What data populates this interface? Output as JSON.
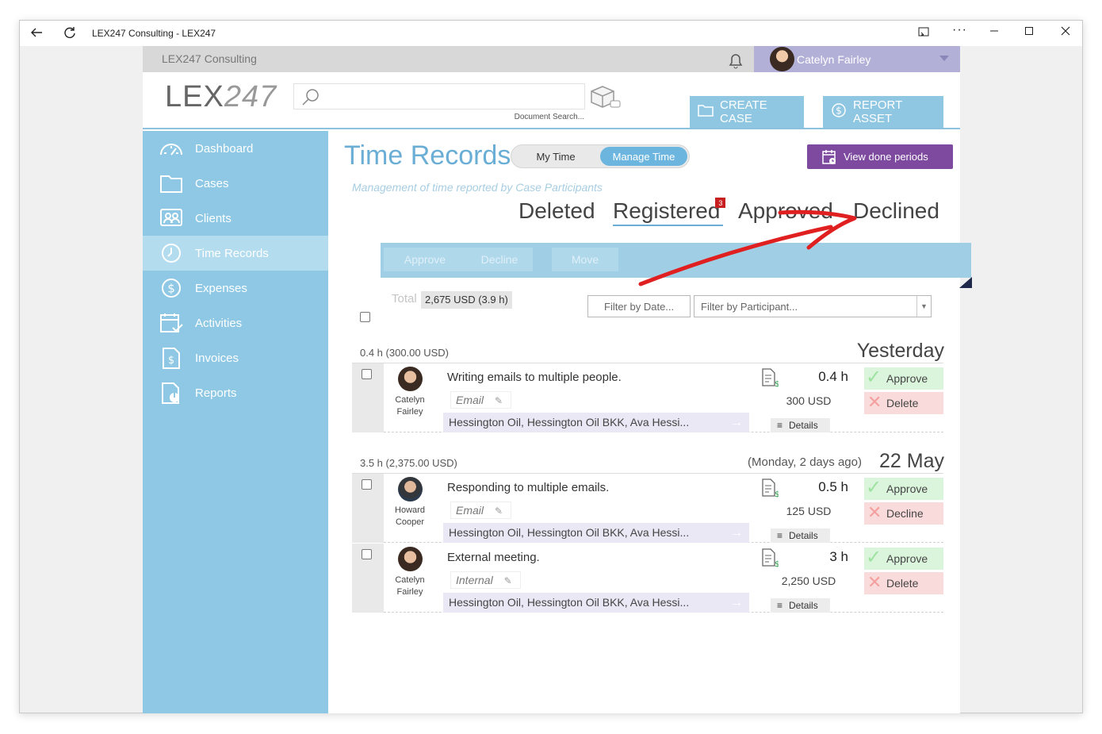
{
  "window": {
    "title": "LEX247 Consulting - LEX247"
  },
  "topbar": {
    "org": "LEX247 Consulting",
    "user_name": "Catelyn Fairley"
  },
  "header": {
    "logo_bold": "LEX",
    "logo_thin": "247",
    "search_hint": "Document Search...",
    "create_case": "CREATE CASE",
    "report_asset": "REPORT ASSET"
  },
  "sidebar": {
    "items": [
      {
        "label": "Dashboard",
        "icon": "gauge-icon"
      },
      {
        "label": "Cases",
        "icon": "folder-icon"
      },
      {
        "label": "Clients",
        "icon": "contacts-icon"
      },
      {
        "label": "Time Records",
        "icon": "clock-icon",
        "active": true
      },
      {
        "label": "Expenses",
        "icon": "dollar-circle-icon"
      },
      {
        "label": "Activities",
        "icon": "calendar-check-icon"
      },
      {
        "label": "Invoices",
        "icon": "invoice-icon"
      },
      {
        "label": "Reports",
        "icon": "report-chart-icon"
      }
    ]
  },
  "main": {
    "title": "Time Records",
    "toggle": {
      "my_time": "My Time",
      "manage_time": "Manage Time",
      "selected": "Manage Time"
    },
    "view_done": "View done periods",
    "subtitle": "Management of time reported by Case Participants",
    "tabs": {
      "deleted": "Deleted",
      "registered": "Registered",
      "registered_badge": "3",
      "approved": "Approved",
      "declined": "Declined",
      "active": "Registered"
    },
    "actions": {
      "approve": "Approve",
      "decline": "Decline",
      "move": "Move"
    },
    "total_label": "Total",
    "total_value": "2,675 USD (3.9 h)",
    "filter_date": "Filter by Date...",
    "filter_participant": "Filter by Participant..."
  },
  "groups": [
    {
      "summary": "0.4 h (300.00 USD)",
      "date": "Yesterday",
      "note": "",
      "entries": [
        {
          "first": "Catelyn",
          "last": "Fairley",
          "desc": "Writing emails to multiple people.",
          "tag": "Email",
          "cases": "Hessington Oil, Hessington Oil BKK, Ava Hessi...",
          "hours": "0.4 h",
          "usd": "300 USD",
          "details": "Details",
          "approve": "Approve",
          "reject": "Delete"
        }
      ]
    },
    {
      "summary": "3.5 h (2,375.00 USD)",
      "date": "22 May",
      "note": "(Monday, 2 days ago)",
      "entries": [
        {
          "first": "Howard",
          "last": "Cooper",
          "desc": "Responding to multiple emails.",
          "tag": "Email",
          "cases": "Hessington Oil, Hessington Oil BKK, Ava Hessi...",
          "hours": "0.5 h",
          "usd": "125 USD",
          "details": "Details",
          "approve": "Approve",
          "reject": "Decline"
        },
        {
          "first": "Catelyn",
          "last": "Fairley",
          "desc": "External meeting.",
          "tag": "Internal",
          "cases": "Hessington Oil, Hessington Oil BKK, Ava Hessi...",
          "hours": "3 h",
          "usd": "2,250 USD",
          "details": "Details",
          "approve": "Approve",
          "reject": "Delete"
        }
      ]
    }
  ],
  "colors": {
    "sidebar": "#8ec8e4",
    "accent": "#6aaed6",
    "view_done": "#7d4aa0",
    "annotation_arrow": "#e02020"
  }
}
